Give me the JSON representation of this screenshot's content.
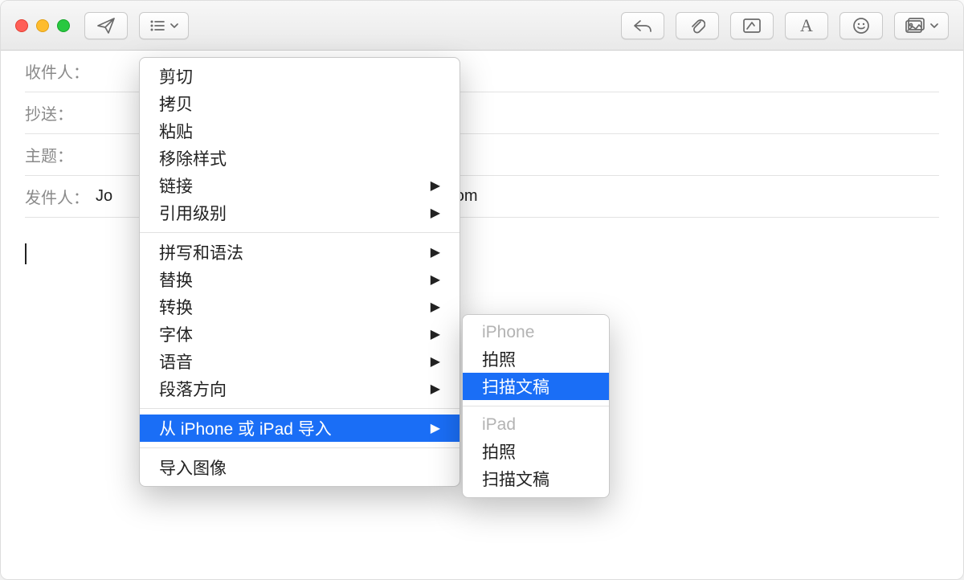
{
  "compose": {
    "to_label": "收件人：",
    "cc_label": "抄送：",
    "subject_label": "主题：",
    "from_label": "发件人：",
    "from_prefix": "Jo",
    "from_suffix": "d.com"
  },
  "menu": {
    "cut": "剪切",
    "copy": "拷贝",
    "paste": "粘贴",
    "remove_style": "移除样式",
    "link": "链接",
    "quote_level": "引用级别",
    "spelling": "拼写和语法",
    "substitutions": "替换",
    "transformations": "转换",
    "font": "字体",
    "speech": "语音",
    "paragraph": "段落方向",
    "import_device": "从 iPhone 或 iPad 导入",
    "import_image": "导入图像"
  },
  "submenu": {
    "iphone_header": "iPhone",
    "iphone_photo": "拍照",
    "iphone_scan": "扫描文稿",
    "ipad_header": "iPad",
    "ipad_photo": "拍照",
    "ipad_scan": "扫描文稿"
  }
}
